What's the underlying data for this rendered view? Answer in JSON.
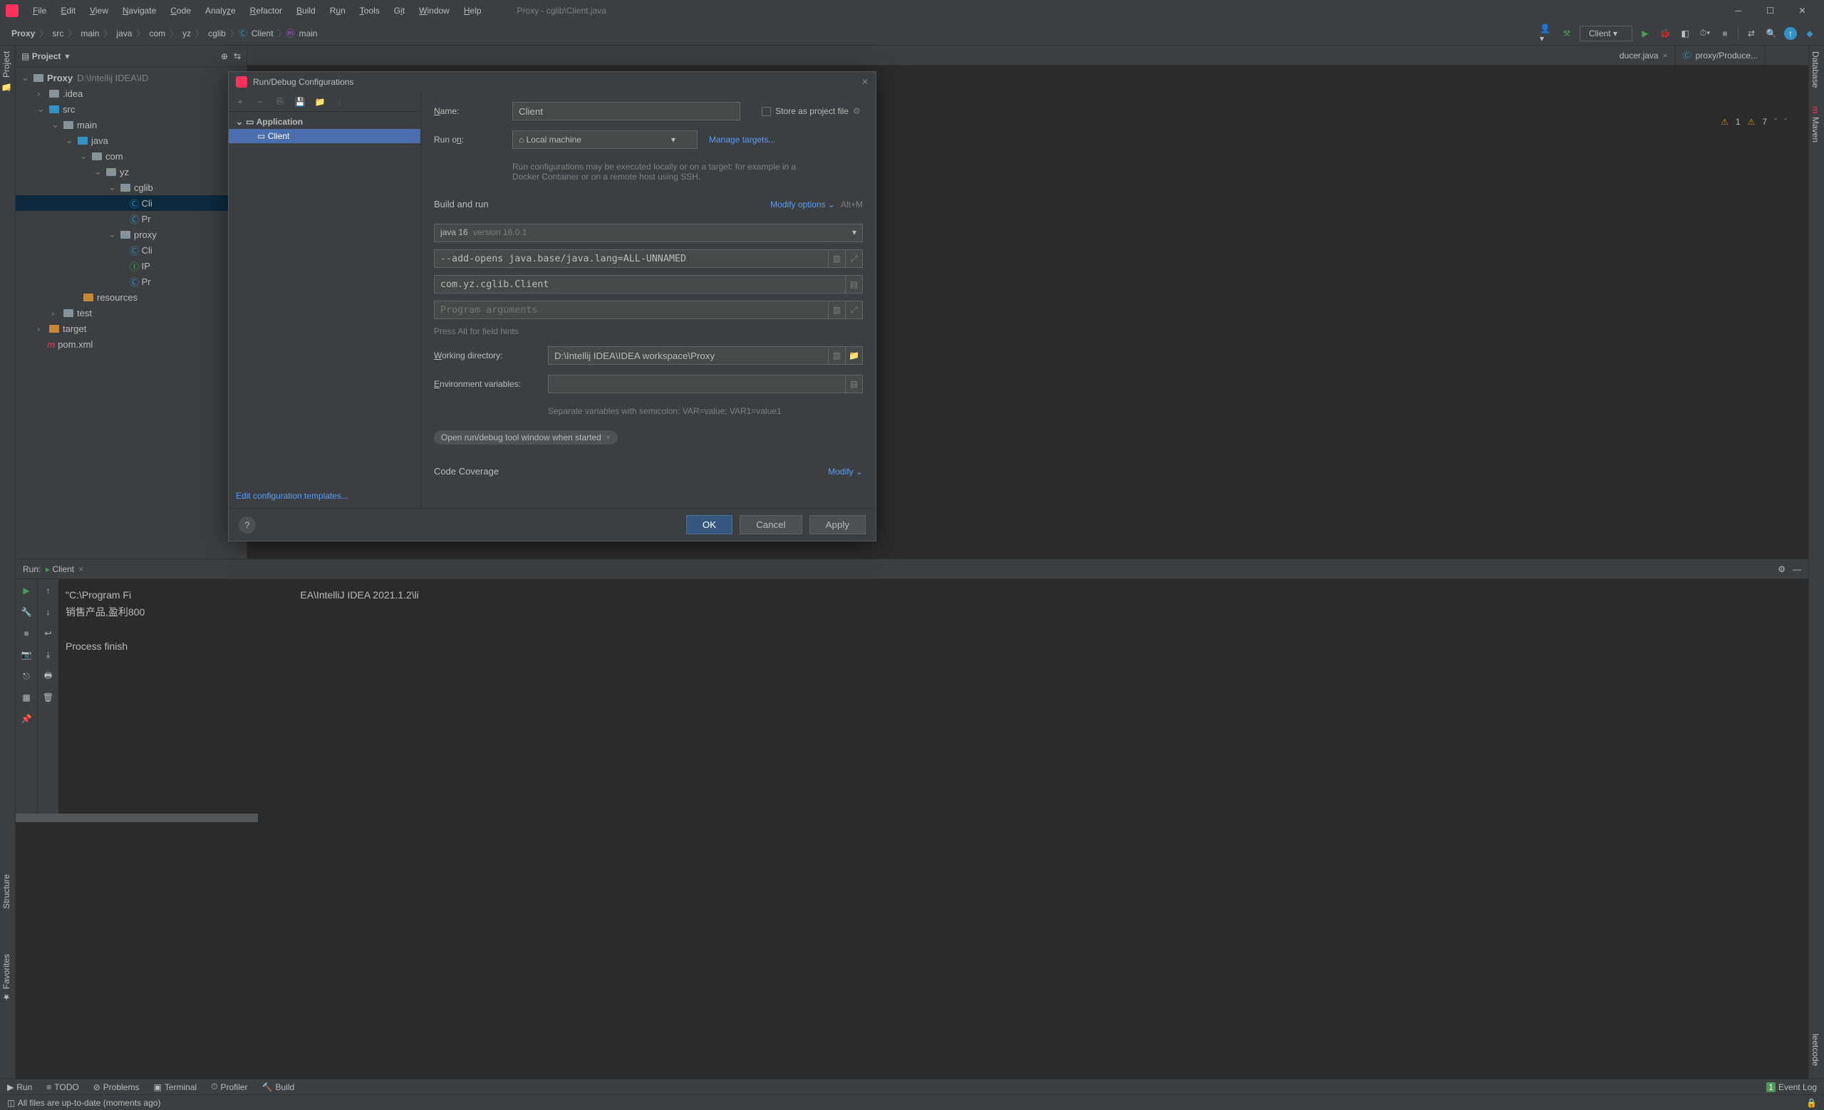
{
  "titlebar": {
    "title": "Proxy - cglib\\Client.java",
    "menu": [
      "File",
      "Edit",
      "View",
      "Navigate",
      "Code",
      "Analyze",
      "Refactor",
      "Build",
      "Run",
      "Tools",
      "Git",
      "Window",
      "Help"
    ]
  },
  "breadcrumb": [
    "Proxy",
    "src",
    "main",
    "java",
    "com",
    "yz",
    "cglib",
    "Client",
    "main"
  ],
  "run_config_selected": "Client",
  "project": {
    "panel_title": "Project",
    "root": "Proxy",
    "root_path": "D:\\Intellij IDEA\\ID",
    "idea_folder": ".idea",
    "src": "src",
    "main": "main",
    "java": "java",
    "com": "com",
    "yz": "yz",
    "cglib": "cglib",
    "cli_trunc": "Cli",
    "pr_trunc": "Pr",
    "proxy_folder": "proxy",
    "ip_trunc": "IP",
    "resources": "resources",
    "test": "test",
    "target": "target",
    "pom": "pom.xml"
  },
  "editor_tabs": {
    "tab1": "ducer.java",
    "tab2": "proxy/Produce..."
  },
  "editor_status": {
    "w1": "1",
    "w2": "7"
  },
  "run": {
    "label": "Run:",
    "config": "Client",
    "line1": "\"C:\\Program Fi                                                             EA\\IntelliJ IDEA 2021.1.2\\li",
    "line2": "销售产品,盈利800",
    "line3": "Process finish"
  },
  "bottom": {
    "run": "Run",
    "todo": "TODO",
    "problems": "Problems",
    "terminal": "Terminal",
    "profiler": "Profiler",
    "build": "Build",
    "eventlog": "Event Log"
  },
  "status_bar": "All files are up-to-date (moments ago)",
  "left_rail": {
    "project": "Project",
    "structure": "Structure",
    "favorites": "Favorites"
  },
  "right_rail": {
    "database": "Database",
    "maven": "Maven",
    "leetcode": "leetcode"
  },
  "dialog": {
    "title": "Run/Debug Configurations",
    "tree": {
      "application": "Application",
      "client": "Client"
    },
    "edit_templates": "Edit configuration templates...",
    "name_label": "Name:",
    "name_value": "Client",
    "store_label": "Store as project file",
    "runon_label": "Run on:",
    "runon_value": "Local machine",
    "manage_targets": "Manage targets...",
    "runon_hint": "Run configurations may be executed locally or on a target: for example in a Docker Container or on a remote host using SSH.",
    "build_run": "Build and run",
    "modify_options": "Modify options",
    "modify_shortcut": "Alt+M",
    "sdk": "java 16",
    "sdk_ver": "version 16.0.1",
    "vm_options": "--add-opens java.base/java.lang=ALL-UNNAMED",
    "main_class": "com.yz.cglib.Client",
    "program_args_placeholder": "Program arguments",
    "hint": "Press Alt for field hints",
    "workdir_label": "Working directory:",
    "workdir_value": "D:\\Intellij IDEA\\IDEA workspace\\Proxy",
    "env_label": "Environment variables:",
    "env_hint": "Separate variables with semicolon: VAR=value; VAR1=value1",
    "chip": "Open run/debug tool window when started",
    "coverage": "Code Coverage",
    "modify": "Modify",
    "ok": "OK",
    "cancel": "Cancel",
    "apply": "Apply"
  }
}
